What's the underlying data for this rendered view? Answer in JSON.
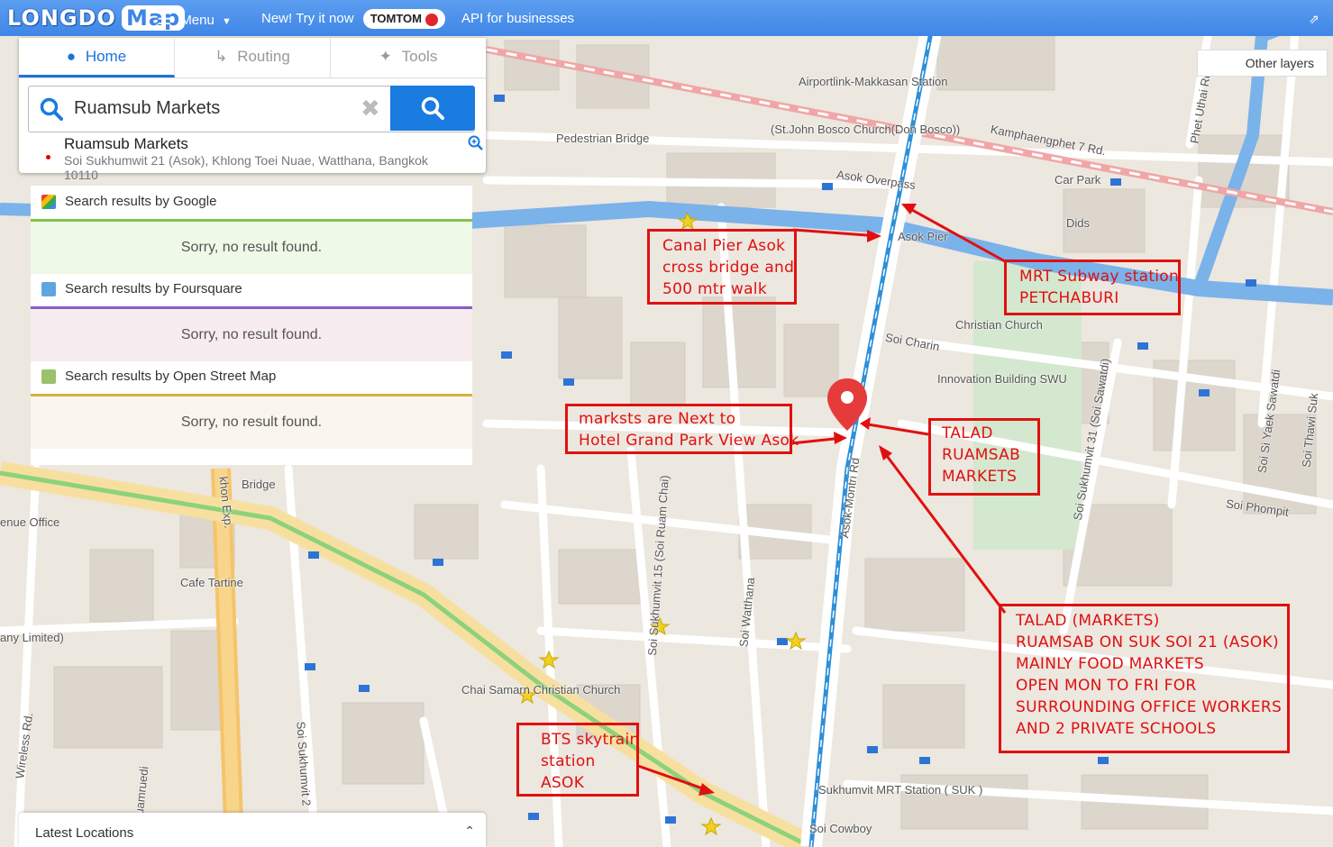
{
  "topbar": {
    "logo_text": "LONGDO",
    "logo_map": "Map",
    "menu_label": "Menu",
    "promo_text": "New! Try it now",
    "tomtom_label": "TOMTOM",
    "api_label": "API for businesses",
    "colors": {
      "bar": "#3f86e6"
    }
  },
  "panel": {
    "tabs": [
      {
        "label": "Home",
        "icon": "pin-icon",
        "active": true
      },
      {
        "label": "Routing",
        "icon": "route-icon",
        "active": false
      },
      {
        "label": "Tools",
        "icon": "pushpin-icon",
        "active": false
      }
    ],
    "search": {
      "value": "Ruamsub Markets"
    },
    "result": {
      "title": "Ruamsub Markets",
      "address_line1": "Soi Sukhumwit 21 (Asok), Khlong Toei Nuae, Watthana, Bangkok",
      "address_line2": "10110"
    },
    "sections": [
      {
        "header": "Search results by Google",
        "message": "Sorry, no result found.",
        "accent": "#7cc44a",
        "bg": "#eef9e8"
      },
      {
        "header": "Search results by Foursquare",
        "message": "Sorry, no result found.",
        "accent": "#8a5ac8",
        "bg": "#f7ecef"
      },
      {
        "header": "Search results by Open Street Map",
        "message": "Sorry, no result found.",
        "accent": "#d8b040",
        "bg": "#faf6ee"
      }
    ]
  },
  "latest": {
    "label": "Latest Locations"
  },
  "other_layers": "Other layers",
  "map_labels": {
    "airport_link": "Airportlink-Makkasan Station",
    "st_john": "(St.John Bosco Church(Don Bosco))",
    "pedestrian_bridge": "Pedestrian Bridge",
    "asok_overpass": "Asok Overpass",
    "kamphaengphet": "Kamphaengphet 7 Rd.",
    "car_park": "Car Park",
    "dids": "Dids",
    "phet_uthai": "Phet Uthai Rd.",
    "asok_pier": "Asok Pier",
    "christian_church": "Christian Church",
    "soi_charin": "Soi Charin",
    "innovation": "Innovation Building SWU",
    "soi_sawatdi": "Soi Sukhumvit 31 (Soi Sawatdi)",
    "soi_yaek": "Soi Si Yaek Sawatdi",
    "soi_thawi": "Soi Thawi Suk",
    "soi_phompit": "Soi Phompit",
    "asok_montri": "Asok-Montri Rd",
    "soi_ruam_chai": "Soi Sukhumvit 15 (Soi Ruam Chai)",
    "soi_watthana": "Soi Watthana",
    "chai_samarn": "Chai Samarn Christian Church",
    "cafe_tartine": "Cafe Tartine",
    "bridge": "Bridge",
    "revenue_office": "enue Office",
    "any_limited": "any Limited)",
    "wireless": "Wireless Rd.",
    "soi_sukhumvit_2": "Soi Sukhumvit 2",
    "ruamruedi": "uamruedi",
    "sukhumvit_mrt": "Sukhumvit MRT Station ( SUK )",
    "soi_cowboy": "Soi Cowboy",
    "khlong_toei_exp": "khon Exp."
  },
  "annotations": {
    "canal_pier": [
      "Canal Pier Asok",
      "cross bridge and",
      "500 mtr walk"
    ],
    "mrt_subway": [
      "MRT Subway station",
      "PETCHABURI"
    ],
    "next_to_hotel": [
      "marksts are Next to",
      "Hotel Grand Park View Asok"
    ],
    "talad_ruamsab": [
      "TALAD",
      "RUAMSAB",
      "MARKETS"
    ],
    "talad_info": [
      "TALAD (MARKETS)",
      "RUAMSAB ON SUK SOI 21 (ASOK)",
      "MAINLY FOOD MARKETS",
      "OPEN MON TO FRI FOR",
      "SURROUNDING OFFICE WORKERS",
      "AND 2 PRIVATE SCHOOLS"
    ],
    "bts": [
      "BTS skytrain",
      "station",
      "ASOK"
    ],
    "color": "#e01010"
  }
}
